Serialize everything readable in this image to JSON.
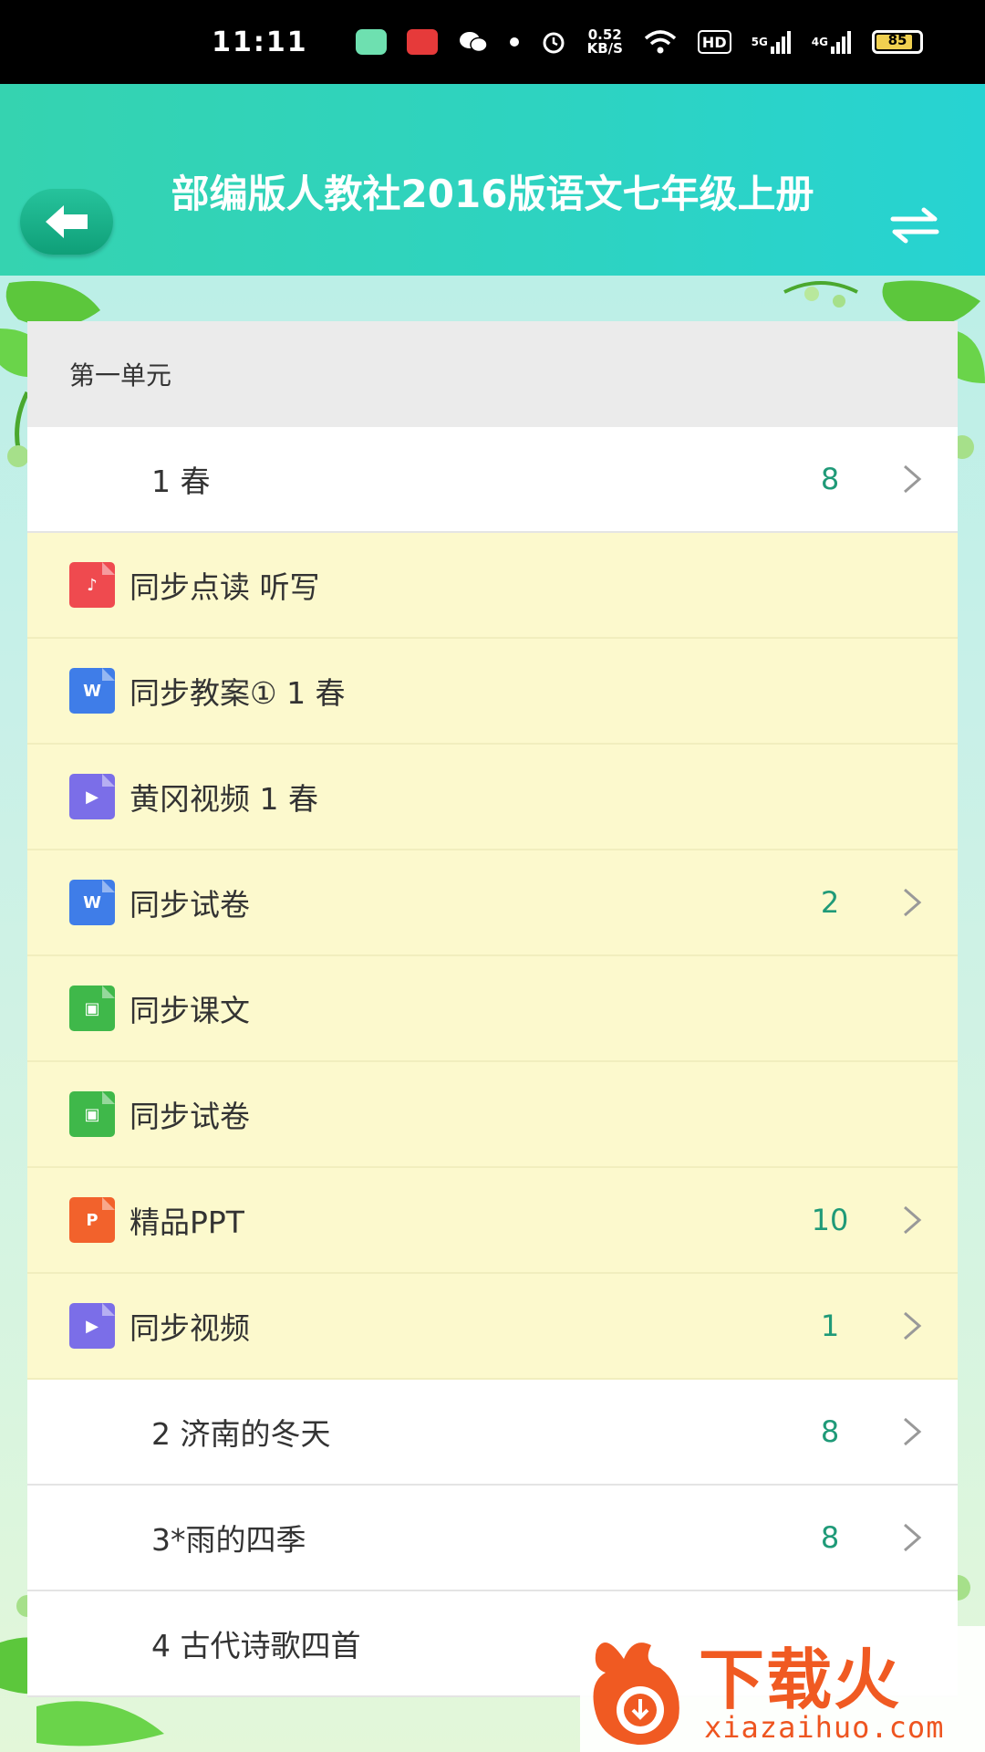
{
  "status_bar": {
    "time": "11:11",
    "net_speed_value": "0.52",
    "net_speed_unit": "KB/S",
    "hd": "HD",
    "sig1": "5G",
    "sig2": "4G",
    "battery": "85"
  },
  "header": {
    "title": "部编版人教社2016版语文七年级上册"
  },
  "section": {
    "title": "第一单元"
  },
  "lessons_top": [
    {
      "label": "1 春",
      "count": "8"
    }
  ],
  "resources": [
    {
      "icon": "music-file-icon",
      "icon_color": "#ef4a4f",
      "icon_text": "♪",
      "label": "同步点读 听写",
      "count": ""
    },
    {
      "icon": "word-file-icon",
      "icon_color": "#3f7de8",
      "icon_text": "W",
      "label": "同步教案① 1 春",
      "count": ""
    },
    {
      "icon": "video-file-icon",
      "icon_color": "#7b6ee8",
      "icon_text": "▶",
      "label": "黄冈视频 1 春",
      "count": ""
    },
    {
      "icon": "word-file-icon",
      "icon_color": "#3f7de8",
      "icon_text": "W",
      "label": "同步试卷",
      "count": "2"
    },
    {
      "icon": "image-file-icon",
      "icon_color": "#3fb84a",
      "icon_text": "▣",
      "label": "同步课文",
      "count": ""
    },
    {
      "icon": "image-file-icon",
      "icon_color": "#3fb84a",
      "icon_text": "▣",
      "label": "同步试卷",
      "count": ""
    },
    {
      "icon": "ppt-file-icon",
      "icon_color": "#f2622c",
      "icon_text": "P",
      "label": "精品PPT",
      "count": "10"
    },
    {
      "icon": "play-file-icon",
      "icon_color": "#7b6ee8",
      "icon_text": "▶",
      "label": "同步视频",
      "count": "1"
    }
  ],
  "lessons_bottom": [
    {
      "label": "2 济南的冬天",
      "count": "8"
    },
    {
      "label": "3*雨的四季",
      "count": "8"
    },
    {
      "label": "4 古代诗歌四首",
      "count": ""
    }
  ],
  "watermark": {
    "brand": "下载火",
    "url": "xiazaihuo.com"
  },
  "colors": {
    "header_gradient_start": "#35d3b0",
    "header_gradient_end": "#27d3d2",
    "count_color": "#1f9a78",
    "resource_bg": "#fcf9cd"
  }
}
